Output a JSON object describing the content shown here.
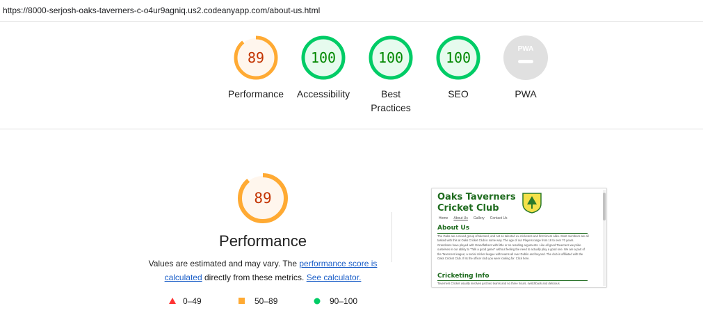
{
  "url": "https://8000-serjosh-oaks-taverners-c-o4ur9agniq.us2.codeanyapp.com/about-us.html",
  "categories": [
    {
      "label": "Performance",
      "score": "89",
      "value": 0.89,
      "color": "#fa3",
      "fill": "#fff6ed",
      "text_color": "#c33300"
    },
    {
      "label": "Accessibility",
      "score": "100",
      "value": 1.0,
      "color": "#0c6",
      "fill": "#e6fbee",
      "text_color": "#008800"
    },
    {
      "label": "Best Practices",
      "score": "100",
      "value": 1.0,
      "color": "#0c6",
      "fill": "#e6fbee",
      "text_color": "#008800"
    },
    {
      "label": "SEO",
      "score": "100",
      "value": 1.0,
      "color": "#0c6",
      "fill": "#e6fbee",
      "text_color": "#008800"
    },
    {
      "label": "PWA",
      "score": "",
      "badge": "PWA"
    }
  ],
  "main": {
    "score": "89",
    "value": 0.89,
    "title": "Performance",
    "desc_prefix": "Values are estimated and may vary. The ",
    "link1": "performance score is calculated",
    "desc_mid": " directly from these metrics. ",
    "link2": "See calculator."
  },
  "legend": [
    {
      "range": "0–49",
      "color": "#f33",
      "shape": "triangle"
    },
    {
      "range": "50–89",
      "color": "#fa3",
      "shape": "square"
    },
    {
      "range": "90–100",
      "color": "#0c6",
      "shape": "circle"
    }
  ],
  "thumbnail": {
    "title_line1": "Oaks Taverners",
    "title_line2": "Cricket Club",
    "nav": [
      "Home",
      "About Us",
      "Gallery",
      "Contact Us"
    ],
    "heading1": "About Us",
    "paragraph": "The Oaks are a mixed group of talented, and not so talented ex-cricketers and first timers alike. Most members are all tasked with this at Oaks Cricket Club in some way. The age of our Players range from 18 to over 70 years. Grandsons have played with Grandfathers with little or no resulting arguments. Like all good Taverners we pride ourselves in our ability to \"Talk a good game\" without feeling the need to actually play a good one. We are a part of the Taverners league; a social cricket league with teams all over Dublin and beyond. The club is affiliated with the Oaks Cricket Club. If its the officer club you were looking for. Click here.",
    "heading2": "Cricketing Info",
    "footer_text": "Taverners Cricket usually involves just two teams and no three hours, switchback and delicious"
  }
}
